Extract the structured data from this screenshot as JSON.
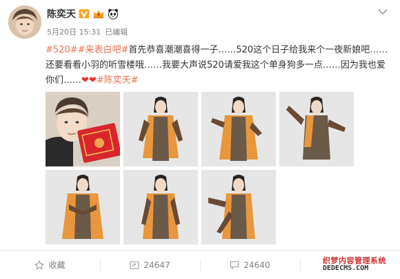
{
  "post": {
    "user_name": "陈奕天",
    "timestamp": "5月20日 15:31",
    "edited_label": "已编辑",
    "text_segments": [
      {
        "type": "tag",
        "text": "#520##来表白吧#"
      },
      {
        "type": "text",
        "text": "首先恭喜潮潮喜得一子……520这个日子给我来个一夜新娘吧……还要看看小羽的听雪楼哦……我要大声说520请爱我这个单身狗多一点……因为我也爱你们……"
      },
      {
        "type": "emoji",
        "text": "❤❤"
      },
      {
        "type": "tag",
        "text": "#陈奕天#"
      }
    ],
    "photos": [
      {
        "name": "photo-selfie-red-envelope"
      },
      {
        "name": "photo-costume-1"
      },
      {
        "name": "photo-costume-2"
      },
      {
        "name": "photo-costume-3"
      },
      {
        "name": "photo-costume-4"
      },
      {
        "name": "photo-costume-5"
      },
      {
        "name": "photo-costume-6"
      }
    ]
  },
  "actions": {
    "favorite_label": "收藏",
    "repost_count": "24647",
    "comment_count": "24640",
    "like_count": ""
  },
  "icons": {
    "verified": "verified-v-icon",
    "vip": "vip-crown-icon",
    "panda": "panda-icon",
    "chevron": "chevron-down-icon",
    "favorite": "star-icon",
    "repost": "repost-icon",
    "comment": "comment-icon",
    "like": "like-icon"
  },
  "watermark": {
    "line1": "织梦内容管理系统",
    "line2": "DEDECMS.COM"
  },
  "colors": {
    "tag": "#eb7350",
    "heart": "#e5352b",
    "verified": "#f5a623",
    "meta": "#808080"
  }
}
